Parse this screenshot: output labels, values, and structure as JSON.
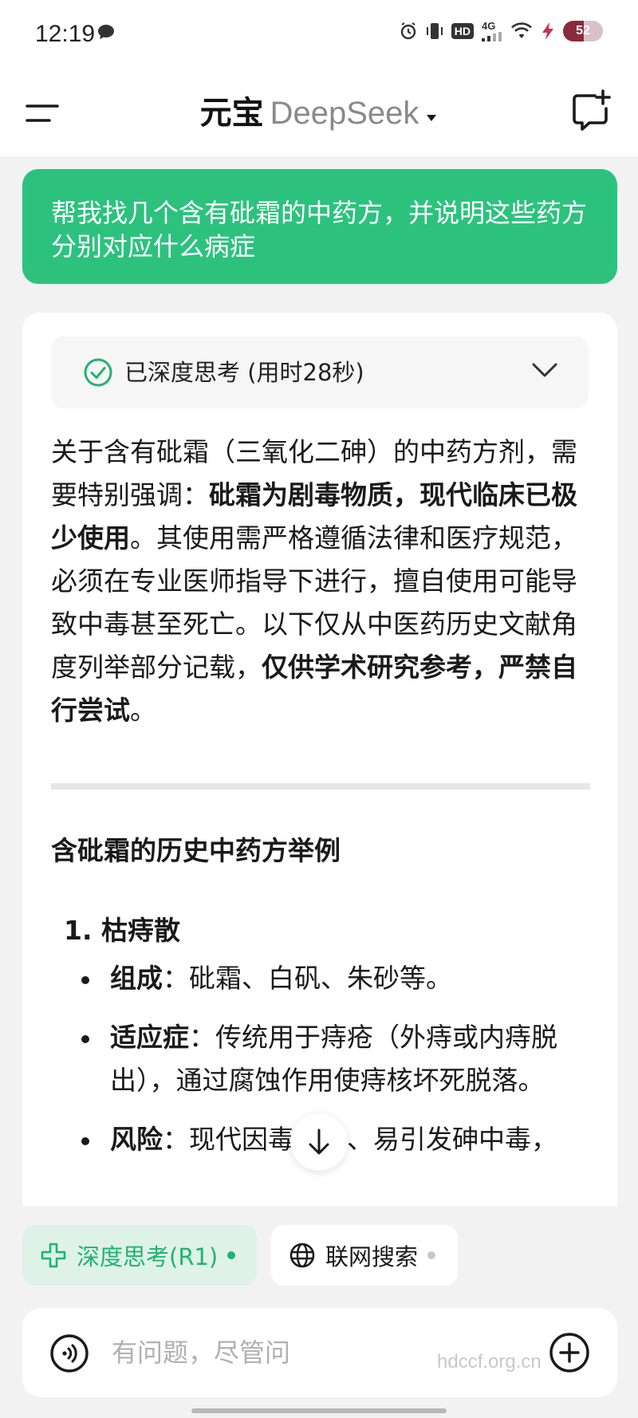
{
  "status_bar": {
    "time": "12:19",
    "hd_label": "HD",
    "network_label": "4G",
    "battery_level": 52,
    "battery_text": "52"
  },
  "header": {
    "title_main": "元宝",
    "title_model": "DeepSeek",
    "icons": [
      "menu-icon",
      "caret-down-icon",
      "new-chat-icon"
    ]
  },
  "user_message": {
    "text": "帮我找几个含有砒霜的中药方，并说明这些药方分别对应什么病症",
    "bubble_color": "#2cc27e"
  },
  "assistant": {
    "thinking_label": "已深度思考 (用时28秒)",
    "intro": {
      "p1": "关于含有砒霜（三氧化二砷）的中药方剂，需要特别强调：",
      "b1": "砒霜为剧毒物质，现代临床已极少使用",
      "p2": "。其使用需严格遵循法律和医疗规范，必须在专业医师指导下进行，擅自使用可能导致中毒甚至死亡。以下仅从中医药历史文献角度列举部分记载，",
      "b2": "仅供学术研究参考，严禁自行尝试",
      "p3": "。"
    },
    "section_heading": "含砒霜的历史中药方举例",
    "item_title": "1. 枯痔散",
    "bullets": [
      {
        "label": "组成",
        "text": "：砒霜、白矾、朱砂等。"
      },
      {
        "label": "适应症",
        "text": "：传统用于痔疮（外痔或内痔脱出），通过腐蚀作用使痔核坏死脱落。"
      },
      {
        "label": "风险",
        "text": "：现代因毒性大、易引发砷中毒，"
      }
    ]
  },
  "chips": {
    "deep_think": "深度思考(R1)",
    "web_search": "联网搜索"
  },
  "input": {
    "placeholder": "有问题，尽管问",
    "value": ""
  },
  "watermark": "hdccf.org.cn",
  "colors": {
    "accent": "#2cc27e",
    "chip_active_bg": "#dff2e8",
    "chip_active_text": "#1fb46e"
  }
}
